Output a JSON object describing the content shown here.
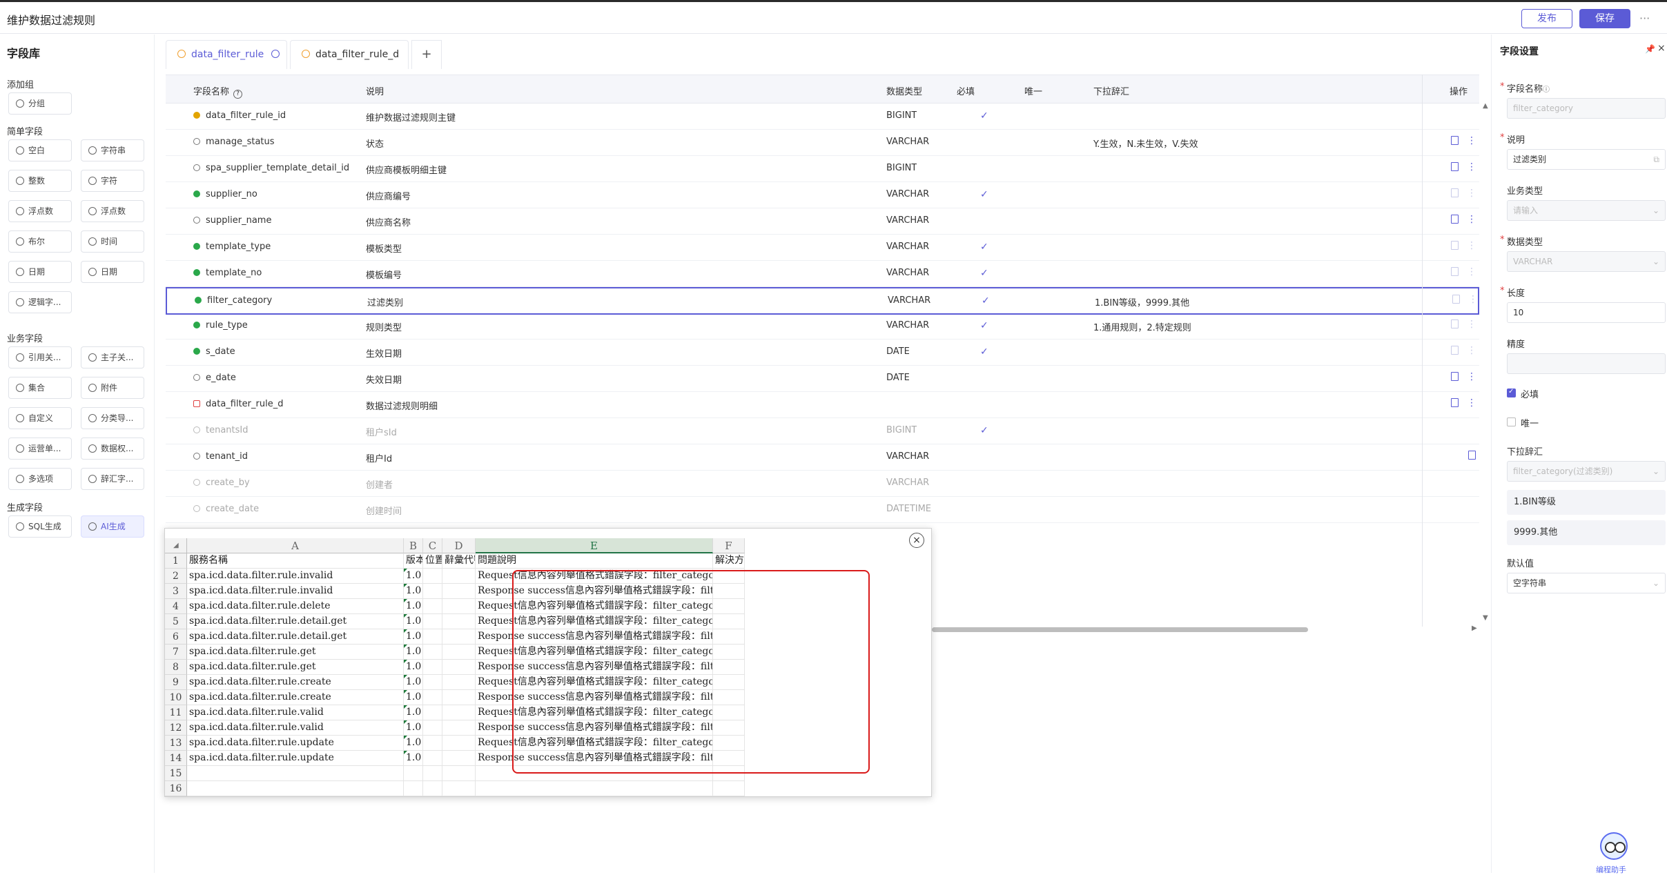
{
  "header": {
    "title": "维护数据过滤规则",
    "publish_label": "发布",
    "save_label": "保存",
    "more": "···"
  },
  "left": {
    "title": "字段库",
    "groups": [
      {
        "label": "添加组",
        "items": [
          {
            "label": "分组",
            "icon": "folder-icon"
          }
        ]
      },
      {
        "label": "简单字段",
        "items": [
          {
            "label": "空白",
            "icon": "circle-icon"
          },
          {
            "label": "字符串",
            "icon": "circle-icon"
          },
          {
            "label": "整数",
            "icon": "circle-icon"
          },
          {
            "label": "字符",
            "icon": "circle-icon"
          },
          {
            "label": "浮点数",
            "icon": "circle-icon"
          },
          {
            "label": "浮点数",
            "icon": "circle-icon"
          },
          {
            "label": "布尔",
            "icon": "circle-icon"
          },
          {
            "label": "时间",
            "icon": "circle-icon"
          },
          {
            "label": "日期",
            "icon": "circle-icon"
          },
          {
            "label": "日期",
            "icon": "circle-icon"
          },
          {
            "label": "逻辑字...",
            "icon": "triangle-icon"
          }
        ]
      },
      {
        "label": "业务字段",
        "items": [
          {
            "label": "引用关...",
            "icon": "link-icon"
          },
          {
            "label": "主子关...",
            "icon": "tree-icon"
          },
          {
            "label": "集合",
            "icon": "cube-icon"
          },
          {
            "label": "附件",
            "icon": "circle-icon"
          },
          {
            "label": "自定义",
            "icon": "circle-icon"
          },
          {
            "label": "分类导...",
            "icon": "circle-icon"
          },
          {
            "label": "运营单...",
            "icon": "circle-icon"
          },
          {
            "label": "数据权...",
            "icon": "circle-icon"
          },
          {
            "label": "多选项",
            "icon": "circle-icon"
          },
          {
            "label": "辞汇字...",
            "icon": "circle-icon"
          }
        ]
      },
      {
        "label": "生成字段",
        "items": [
          {
            "label": "SQL生成",
            "icon": "image-icon"
          },
          {
            "label": "AI生成",
            "icon": "robot-icon"
          }
        ]
      }
    ]
  },
  "tabs": [
    {
      "label": "data_filter_rule"
    },
    {
      "label": "data_filter_rule_d"
    }
  ],
  "tab_add": "+",
  "table": {
    "headers": {
      "name": "字段名称",
      "desc": "说明",
      "type": "数据类型",
      "required": "必填",
      "unique": "唯一",
      "dict": "下拉辞汇",
      "ops": "操作"
    },
    "help": "?",
    "rows": [
      {
        "name": "data_filter_rule_id",
        "desc": "维护数据过滤规则主键",
        "type": "BIGINT",
        "required": "✓",
        "dict": "",
        "icon": "gold-key",
        "ops": "none",
        "grey": false
      },
      {
        "name": "manage_status",
        "desc": "状态",
        "type": "VARCHAR",
        "required": "",
        "dict": "Y.生效，N.未生效，V.失效",
        "icon": "ring",
        "ops": "active",
        "grey": false
      },
      {
        "name": "spa_supplier_template_detail_id",
        "desc": "供应商模板明细主键",
        "type": "BIGINT",
        "required": "",
        "dict": "",
        "icon": "ring",
        "ops": "active",
        "grey": false
      },
      {
        "name": "supplier_no",
        "desc": "供应商编号",
        "type": "VARCHAR",
        "required": "✓",
        "dict": "",
        "icon": "green-key",
        "ops": "dim",
        "grey": false
      },
      {
        "name": "supplier_name",
        "desc": "供应商名称",
        "type": "VARCHAR",
        "required": "",
        "dict": "",
        "icon": "ring",
        "ops": "active",
        "grey": false
      },
      {
        "name": "template_type",
        "desc": "模板类型",
        "type": "VARCHAR",
        "required": "✓",
        "dict": "",
        "icon": "green-key",
        "ops": "dim",
        "grey": false
      },
      {
        "name": "template_no",
        "desc": "模板编号",
        "type": "VARCHAR",
        "required": "✓",
        "dict": "",
        "icon": "green-key",
        "ops": "dim",
        "grey": false
      },
      {
        "name": "filter_category",
        "desc": "过滤类别",
        "type": "VARCHAR",
        "required": "✓",
        "dict": "1.BIN等级，9999.其他",
        "icon": "green-key",
        "ops": "dim",
        "grey": false,
        "selected": true
      },
      {
        "name": "rule_type",
        "desc": "规则类型",
        "type": "VARCHAR",
        "required": "✓",
        "dict": "1.通用规则，2.特定规则",
        "icon": "green-key",
        "ops": "dim",
        "grey": false
      },
      {
        "name": "s_date",
        "desc": "生效日期",
        "type": "DATE",
        "required": "✓",
        "dict": "",
        "icon": "green-key",
        "ops": "dim",
        "grey": false
      },
      {
        "name": "e_date",
        "desc": "失效日期",
        "type": "DATE",
        "required": "",
        "dict": "",
        "icon": "ring",
        "ops": "active",
        "grey": false
      },
      {
        "name": "data_filter_rule_d",
        "desc": "数据过滤规则明细",
        "type": "",
        "required": "",
        "dict": "",
        "icon": "red-tree",
        "ops": "active",
        "grey": false
      },
      {
        "name": "tenantsId",
        "desc": "租户sId",
        "type": "BIGINT",
        "required": "✓",
        "dict": "",
        "icon": "ring",
        "ops": "none",
        "grey": true
      },
      {
        "name": "tenant_id",
        "desc": "租户Id",
        "type": "VARCHAR",
        "required": "",
        "dict": "",
        "icon": "ring",
        "ops": "trash-only",
        "grey": false
      },
      {
        "name": "create_by",
        "desc": "创建者",
        "type": "VARCHAR",
        "required": "",
        "dict": "",
        "icon": "ring",
        "ops": "none",
        "grey": true
      },
      {
        "name": "create_date",
        "desc": "创建时间",
        "type": "DATETIME",
        "required": "",
        "dict": "",
        "icon": "ring",
        "ops": "none",
        "grey": true
      }
    ]
  },
  "right": {
    "title": "字段设置",
    "pin": "📌",
    "close": "×",
    "field_name_label": "字段名称",
    "field_name_placeholder": "filter_category",
    "desc_label": "说明",
    "desc_value": "过滤类别",
    "biz_type_label": "业务类型",
    "biz_type_placeholder": "请输入",
    "data_type_label": "数据类型",
    "data_type_value": "VARCHAR",
    "length_label": "长度",
    "length_value": "10",
    "precision_label": "精度",
    "required_label": "必填",
    "required_checked": true,
    "unique_label": "唯一",
    "unique_checked": false,
    "dict_label": "下拉辞汇",
    "dict_value": "filter_category(过滤类别)",
    "dict_items": [
      "1.BIN等级",
      "9999.其他"
    ],
    "default_label": "默认值",
    "default_value": "空字符串",
    "assistant_label": "编程助手"
  },
  "spreadsheet": {
    "close": "×",
    "corner": "◢",
    "columns": [
      "A",
      "B",
      "C",
      "D",
      "E",
      "F"
    ],
    "selected_column": "E",
    "header_row": [
      "服務名稱",
      "版本",
      "位置",
      "辭彙代號",
      "問題說明",
      "解決方案"
    ],
    "rows": [
      [
        "spa.icd.data.filter.rule.invalid",
        "1.0",
        "",
        "",
        "Request信息內容列舉值格式錯誤字段：filter_category",
        ""
      ],
      [
        "spa.icd.data.filter.rule.invalid",
        "1.0",
        "",
        "",
        "Response success信息內容列舉值格式錯誤字段：filter_category",
        ""
      ],
      [
        "spa.icd.data.filter.rule.delete",
        "1.0",
        "",
        "",
        "Request信息內容列舉值格式錯誤字段：filter_category",
        ""
      ],
      [
        "spa.icd.data.filter.rule.detail.get",
        "1.0",
        "",
        "",
        "Request信息內容列舉值格式錯誤字段：filter_category",
        ""
      ],
      [
        "spa.icd.data.filter.rule.detail.get",
        "1.0",
        "",
        "",
        "Response success信息內容列舉值格式錯誤字段：filter_category",
        ""
      ],
      [
        "spa.icd.data.filter.rule.get",
        "1.0",
        "",
        "",
        "Request信息內容列舉值格式錯誤字段：filter_category",
        ""
      ],
      [
        "spa.icd.data.filter.rule.get",
        "1.0",
        "",
        "",
        "Response success信息內容列舉值格式錯誤字段：filter_category",
        ""
      ],
      [
        "spa.icd.data.filter.rule.create",
        "1.0",
        "",
        "",
        "Request信息內容列舉值格式錯誤字段：filter_category",
        ""
      ],
      [
        "spa.icd.data.filter.rule.create",
        "1.0",
        "",
        "",
        "Response success信息內容列舉值格式錯誤字段：filter_category",
        ""
      ],
      [
        "spa.icd.data.filter.rule.valid",
        "1.0",
        "",
        "",
        "Request信息內容列舉值格式錯誤字段：filter_category",
        ""
      ],
      [
        "spa.icd.data.filter.rule.valid",
        "1.0",
        "",
        "",
        "Response success信息內容列舉值格式錯誤字段：filter_category",
        ""
      ],
      [
        "spa.icd.data.filter.rule.update",
        "1.0",
        "",
        "",
        "Request信息內容列舉值格式錯誤字段：filter_category",
        ""
      ],
      [
        "spa.icd.data.filter.rule.update",
        "1.0",
        "",
        "",
        "Response success信息內容列舉值格式錯誤字段：filter_category",
        ""
      ]
    ],
    "row_numbers": [
      "1",
      "2",
      "3",
      "4",
      "5",
      "6",
      "7",
      "8",
      "9",
      "10",
      "11",
      "12",
      "13",
      "14",
      "15",
      "16"
    ]
  }
}
